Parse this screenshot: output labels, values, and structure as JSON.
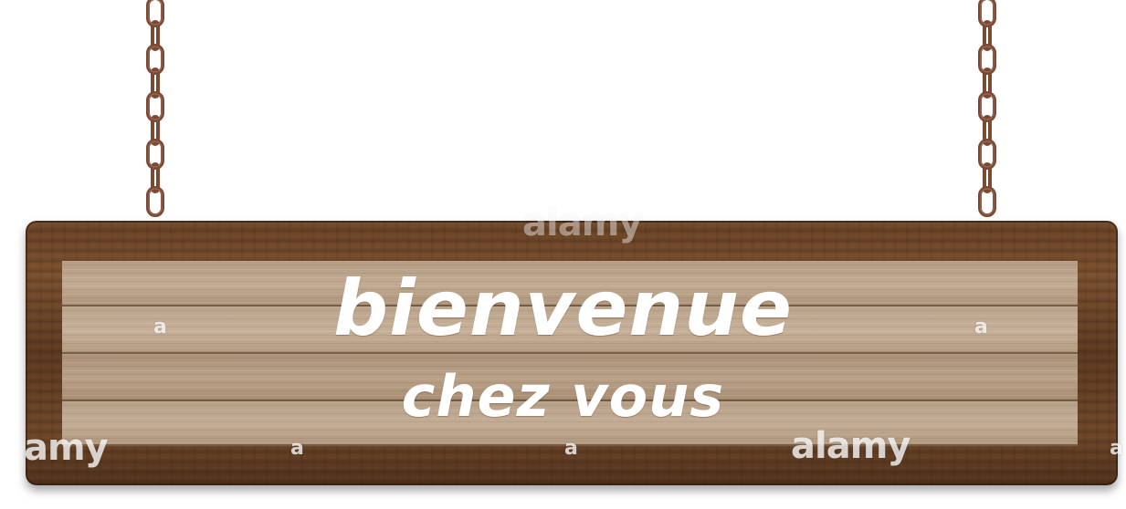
{
  "sign": {
    "line1": "bienvenue",
    "line2": "chez vous"
  },
  "watermarks": {
    "top_center": "alamy",
    "bottom_left": "amy",
    "bottom_right": "alamy",
    "mark_a": "a"
  },
  "colors": {
    "frame_wood": "#6a4326",
    "plank_wood": "#b9a188",
    "chain_rust": "#7a4a35",
    "text": "#ffffff"
  },
  "icons": {
    "chain_left": "chain-icon",
    "chain_right": "chain-icon"
  }
}
